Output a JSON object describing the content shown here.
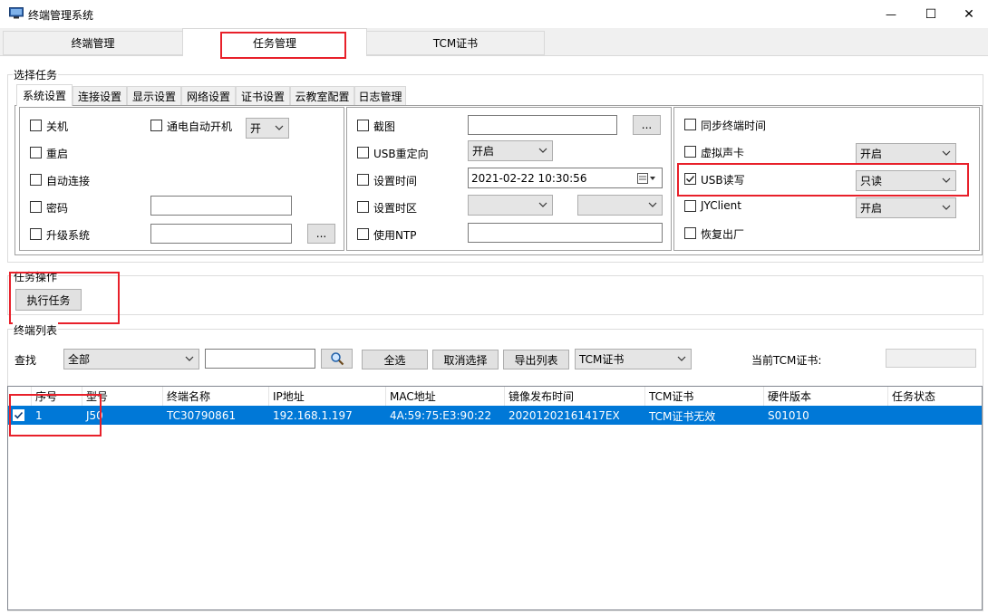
{
  "window": {
    "title": "终端管理系统",
    "minimize_glyph": "—",
    "maximize_glyph": "☐",
    "close_glyph": "✕"
  },
  "top_tabs": [
    {
      "label": "终端管理"
    },
    {
      "label": "任务管理",
      "selected": true
    },
    {
      "label": "TCM证书"
    }
  ],
  "task_select": {
    "group_label": "选择任务",
    "tabs": [
      "系统设置",
      "连接设置",
      "显示设置",
      "网络设置",
      "证书设置",
      "云教室配置",
      "日志管理"
    ],
    "col1": {
      "shutdown": "关机",
      "power_on_auto": "通电自动开机",
      "power_on_value": "开",
      "restart": "重启",
      "auto_connect": "自动连接",
      "password": "密码",
      "password_value": "",
      "upgrade": "升级系统",
      "upgrade_value": "",
      "browse": "..."
    },
    "col2": {
      "screenshot": "截图",
      "screenshot_value": "",
      "browse": "...",
      "usb_redirect": "USB重定向",
      "usb_redirect_value": "开启",
      "set_time": "设置时间",
      "set_time_value": "2021-02-22  10:30:56",
      "set_timezone": "设置时区",
      "timezone_value1": "",
      "timezone_value2": "",
      "use_ntp": "使用NTP",
      "ntp_value": ""
    },
    "col3": {
      "sync_time": "同步终端时间",
      "virtual_sound": "虚拟声卡",
      "virtual_sound_value": "开启",
      "usb_rw": "USB读写",
      "usb_rw_checked": true,
      "usb_rw_value": "只读",
      "jyclient": "JYClient",
      "jyclient_value": "开启",
      "factory_reset": "恢复出厂"
    }
  },
  "task_ops": {
    "group_label": "任务操作",
    "execute_button": "执行任务"
  },
  "terminal_list": {
    "group_label": "终端列表",
    "find_label": "查找",
    "find_scope": "全部",
    "find_value": "",
    "select_all": "全选",
    "deselect": "取消选择",
    "export": "导出列表",
    "cert_filter": "TCM证书",
    "current_cert_label": "当前TCM证书:",
    "current_cert_value": "",
    "columns": [
      "序号",
      "型号",
      "终端名称",
      "IP地址",
      "MAC地址",
      "镜像发布时间",
      "TCM证书",
      "硬件版本",
      "任务状态"
    ],
    "rows": [
      {
        "checked": true,
        "cells": [
          "1",
          "J50",
          "TC30790861",
          "192.168.1.197",
          "4A:59:75:E3:90:22",
          "20201202161417EX",
          "TCM证书无效",
          "S01010",
          ""
        ]
      }
    ]
  },
  "colors": {
    "selection": "#0078d7",
    "highlight_box": "#e8202a"
  }
}
